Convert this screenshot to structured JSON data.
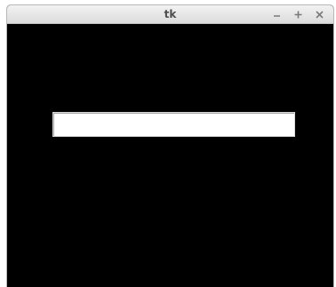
{
  "window": {
    "title": "tk",
    "controls": [
      {
        "name": "minimize",
        "icon": "minus-icon"
      },
      {
        "name": "maximize",
        "icon": "plus-icon"
      },
      {
        "name": "close",
        "icon": "close-icon"
      }
    ]
  },
  "entry": {
    "value": "",
    "placeholder": ""
  },
  "colors": {
    "content_background": "#000000",
    "entry_background": "#ffffff",
    "titlebar_text": "#4d4d4d"
  }
}
